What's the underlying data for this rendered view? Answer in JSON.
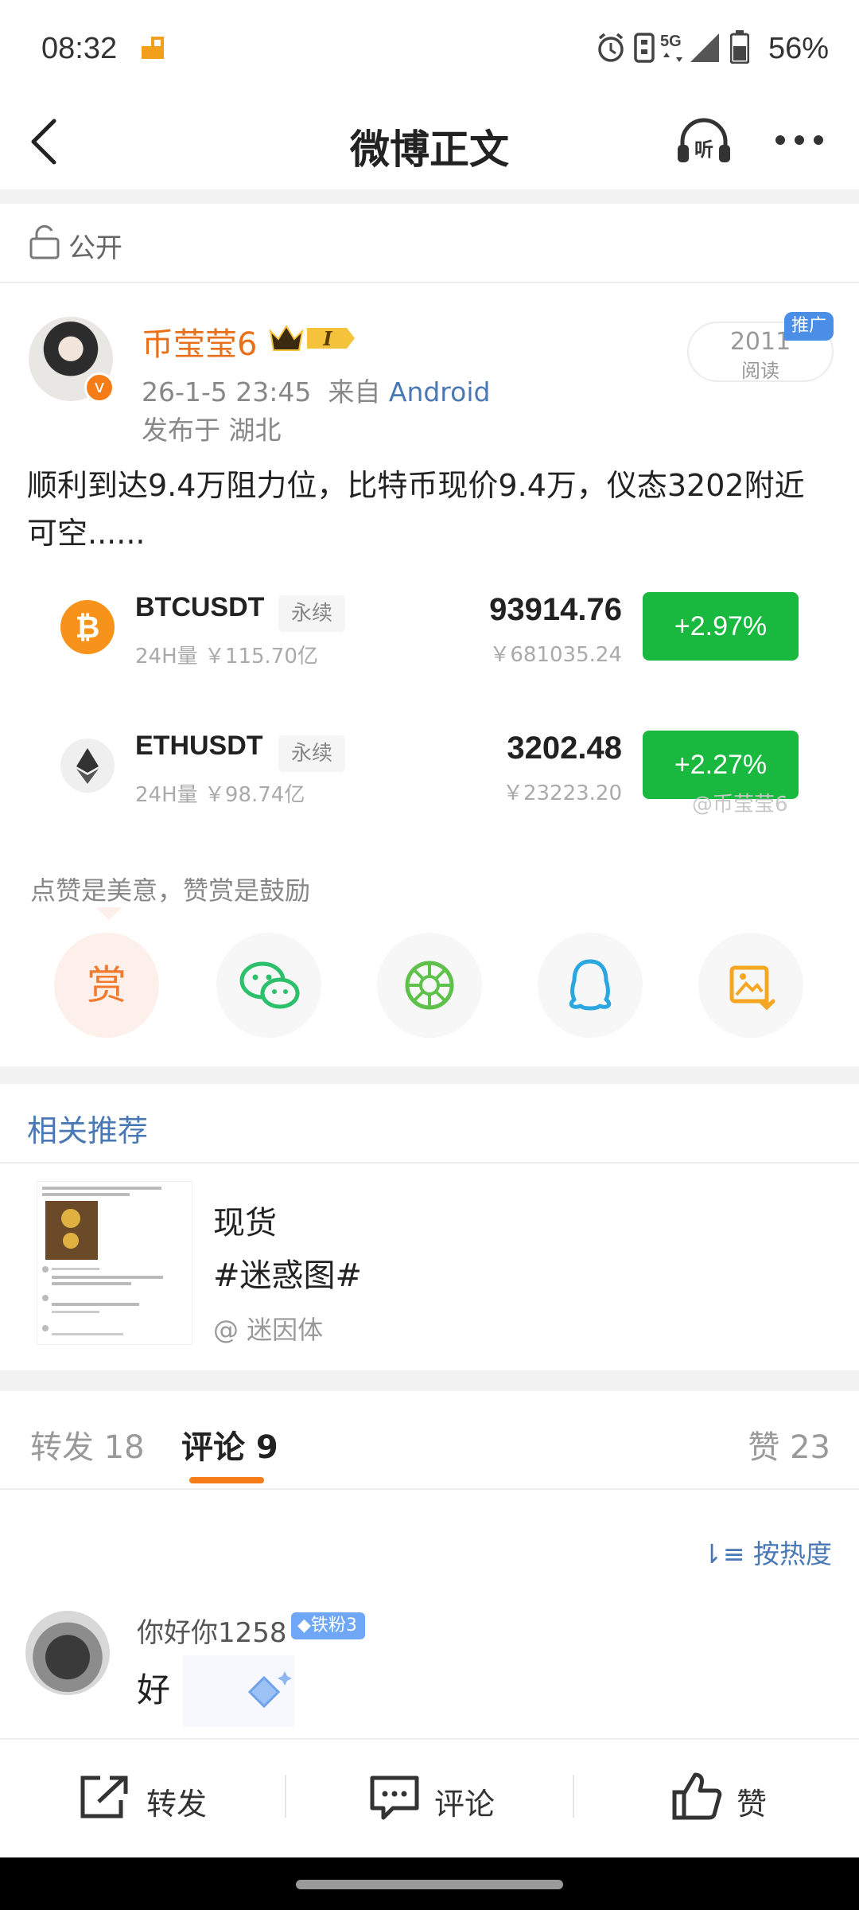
{
  "status_bar": {
    "time": "08:32",
    "battery": "56%",
    "network": "5G"
  },
  "nav": {
    "title": "微博正文",
    "listen_label": "听"
  },
  "visibility": {
    "label": "公开"
  },
  "post": {
    "username": "币莹莹6",
    "crown_level": "I",
    "timestamp": "26-1-5 23:45",
    "source_prefix": "来自",
    "source": "Android",
    "location": "发布于 湖北",
    "read_count": "2011",
    "read_label": "阅读",
    "ad_tag": "推广",
    "text": "顺利到达9.4万阻力位，比特币现价9.4万，仪态3202附近可空......"
  },
  "tickers": [
    {
      "symbol": "BTCUSDT",
      "type": "永续",
      "volume": "24H量 ￥115.70亿",
      "price": "93914.76",
      "cny": "￥681035.24",
      "change": "+2.97%"
    },
    {
      "symbol": "ETHUSDT",
      "type": "永续",
      "volume": "24H量 ￥98.74亿",
      "price": "3202.48",
      "cny": "￥23223.20",
      "change": "+2.27%"
    }
  ],
  "watermark": "@币莹莹6",
  "share": {
    "encourage_text": "点赞是美意，赞赏是鼓励",
    "tip_label": "赏",
    "icons": [
      "wechat-icon",
      "moments-icon",
      "qq-icon",
      "save-image-icon"
    ]
  },
  "related": {
    "title": "相关推荐",
    "item": {
      "line1": "现货",
      "line2": "#迷惑图#",
      "author": "@ 迷因体"
    }
  },
  "tabs": {
    "repost": "转发 18",
    "comment": "评论 9",
    "like": "赞 23",
    "sort_label": "按热度"
  },
  "comment": {
    "username": "你好你1258",
    "badge": "铁粉3",
    "text": "好"
  },
  "bottom_bar": {
    "repost": "转发",
    "comment": "评论",
    "like": "赞"
  },
  "colors": {
    "accent_orange": "#f57c17",
    "link_blue": "#4a78b4",
    "up_green": "#19b93f"
  }
}
